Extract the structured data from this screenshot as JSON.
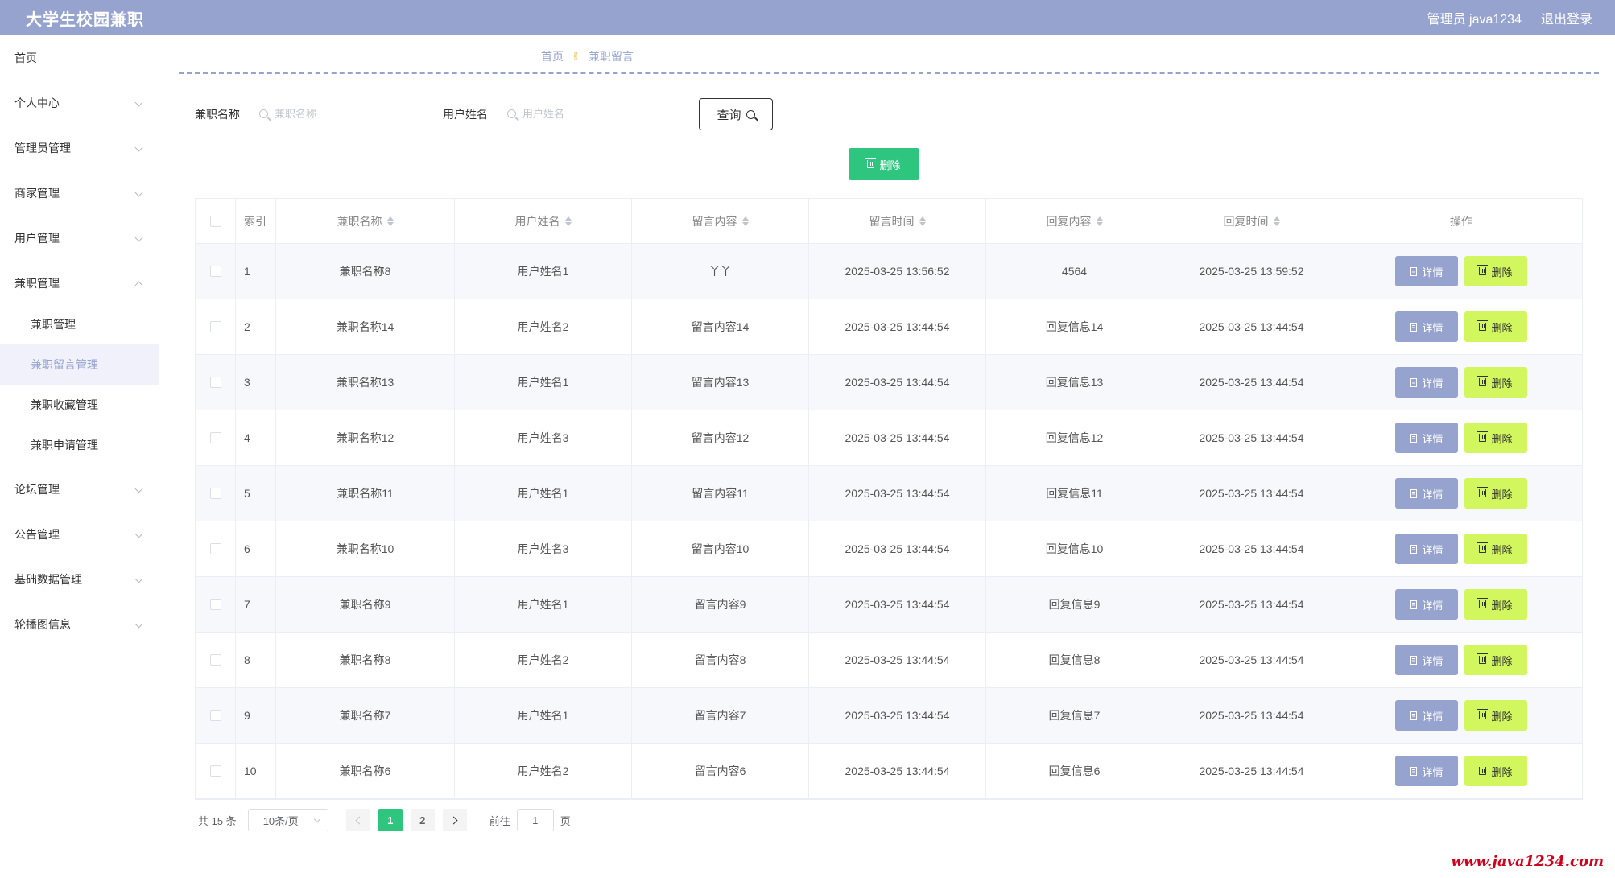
{
  "header": {
    "app_title": "大学生校园兼职",
    "admin_label": "管理员 java1234",
    "logout_label": "退出登录"
  },
  "sidebar": {
    "items": [
      {
        "label": "首页",
        "has_children": false
      },
      {
        "label": "个人中心",
        "has_children": true
      },
      {
        "label": "管理员管理",
        "has_children": true
      },
      {
        "label": "商家管理",
        "has_children": true
      },
      {
        "label": "用户管理",
        "has_children": true
      },
      {
        "label": "兼职管理",
        "has_children": true,
        "expanded": true
      },
      {
        "label": "论坛管理",
        "has_children": true
      },
      {
        "label": "公告管理",
        "has_children": true
      },
      {
        "label": "基础数据管理",
        "has_children": true
      },
      {
        "label": "轮播图信息",
        "has_children": true
      }
    ],
    "submenu": [
      {
        "label": "兼职管理",
        "active": false
      },
      {
        "label": "兼职留言管理",
        "active": true
      },
      {
        "label": "兼职收藏管理",
        "active": false
      },
      {
        "label": "兼职申请管理",
        "active": false
      }
    ]
  },
  "breadcrumb": {
    "home": "首页",
    "current": "兼职留言"
  },
  "search": {
    "job_label": "兼职名称",
    "job_placeholder": "兼职名称",
    "user_label": "用户姓名",
    "user_placeholder": "用户姓名",
    "query_label": "查询"
  },
  "bulk_delete_label": "删除",
  "table": {
    "headers": {
      "index": "索引",
      "job_name": "兼职名称",
      "user_name": "用户姓名",
      "message": "留言内容",
      "message_time": "留言时间",
      "reply": "回复内容",
      "reply_time": "回复时间",
      "operations": "操作"
    },
    "detail_label": "详情",
    "delete_label": "删除",
    "rows": [
      {
        "index": "1",
        "job_name": "兼职名称8",
        "user_name": "用户姓名1",
        "message": "丫丫",
        "message_time": "2025-03-25 13:56:52",
        "reply": "4564",
        "reply_time": "2025-03-25 13:59:52"
      },
      {
        "index": "2",
        "job_name": "兼职名称14",
        "user_name": "用户姓名2",
        "message": "留言内容14",
        "message_time": "2025-03-25 13:44:54",
        "reply": "回复信息14",
        "reply_time": "2025-03-25 13:44:54"
      },
      {
        "index": "3",
        "job_name": "兼职名称13",
        "user_name": "用户姓名1",
        "message": "留言内容13",
        "message_time": "2025-03-25 13:44:54",
        "reply": "回复信息13",
        "reply_time": "2025-03-25 13:44:54"
      },
      {
        "index": "4",
        "job_name": "兼职名称12",
        "user_name": "用户姓名3",
        "message": "留言内容12",
        "message_time": "2025-03-25 13:44:54",
        "reply": "回复信息12",
        "reply_time": "2025-03-25 13:44:54"
      },
      {
        "index": "5",
        "job_name": "兼职名称11",
        "user_name": "用户姓名1",
        "message": "留言内容11",
        "message_time": "2025-03-25 13:44:54",
        "reply": "回复信息11",
        "reply_time": "2025-03-25 13:44:54"
      },
      {
        "index": "6",
        "job_name": "兼职名称10",
        "user_name": "用户姓名3",
        "message": "留言内容10",
        "message_time": "2025-03-25 13:44:54",
        "reply": "回复信息10",
        "reply_time": "2025-03-25 13:44:54"
      },
      {
        "index": "7",
        "job_name": "兼职名称9",
        "user_name": "用户姓名1",
        "message": "留言内容9",
        "message_time": "2025-03-25 13:44:54",
        "reply": "回复信息9",
        "reply_time": "2025-03-25 13:44:54"
      },
      {
        "index": "8",
        "job_name": "兼职名称8",
        "user_name": "用户姓名2",
        "message": "留言内容8",
        "message_time": "2025-03-25 13:44:54",
        "reply": "回复信息8",
        "reply_time": "2025-03-25 13:44:54"
      },
      {
        "index": "9",
        "job_name": "兼职名称7",
        "user_name": "用户姓名1",
        "message": "留言内容7",
        "message_time": "2025-03-25 13:44:54",
        "reply": "回复信息7",
        "reply_time": "2025-03-25 13:44:54"
      },
      {
        "index": "10",
        "job_name": "兼职名称6",
        "user_name": "用户姓名2",
        "message": "留言内容6",
        "message_time": "2025-03-25 13:44:54",
        "reply": "回复信息6",
        "reply_time": "2025-03-25 13:44:54"
      }
    ]
  },
  "pagination": {
    "total": "共 15 条",
    "page_size": "10条/页",
    "pages": [
      "1",
      "2"
    ],
    "current_page": "1",
    "goto_prefix": "前往",
    "goto_value": "1",
    "goto_suffix": "页"
  },
  "watermark": "www.java1234.com",
  "colors": {
    "header": "#96a3cf",
    "primary_green": "#2ec57e",
    "detail_button": "#96a3cf",
    "delete_button": "#d2f65d",
    "watermark": "#d0021b"
  }
}
